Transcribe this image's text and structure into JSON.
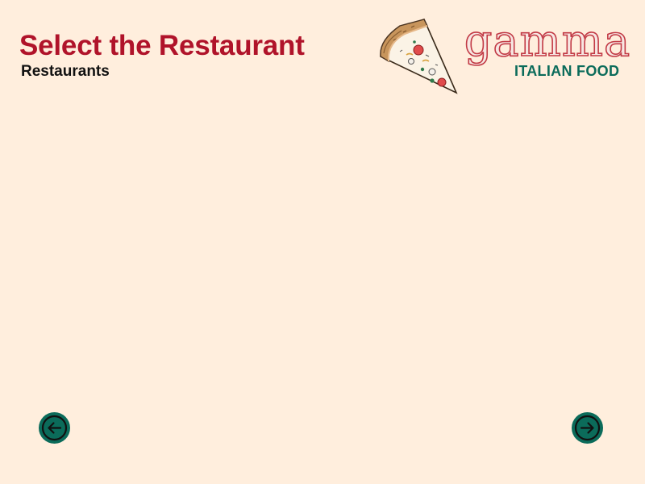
{
  "header": {
    "title": "Select the Restaurant",
    "section_label": "Restaurants"
  },
  "brand": {
    "name": "gamma",
    "tagline": "ITALIAN FOOD",
    "icon": "pizza-slice-icon"
  },
  "navigation": {
    "prev_icon": "arrow-left-icon",
    "next_icon": "arrow-right-icon"
  },
  "colors": {
    "background": "#ffeedd",
    "title": "#b0132a",
    "accent": "#0b6b5a"
  }
}
